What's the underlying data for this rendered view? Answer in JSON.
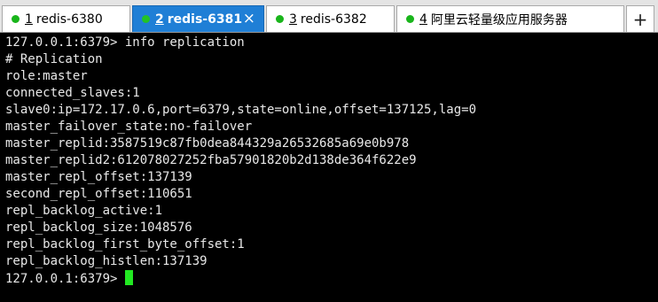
{
  "tabs": [
    {
      "num": "1",
      "label": "redis-6380",
      "active": false
    },
    {
      "num": "2",
      "label": "redis-6381",
      "active": true
    },
    {
      "num": "3",
      "label": "redis-6382",
      "active": false
    },
    {
      "num": "4",
      "label": "阿里云轻量级应用服务器",
      "active": false
    }
  ],
  "tab_close_glyph": "×",
  "add_tab_glyph": "+",
  "terminal": {
    "lines": [
      "127.0.0.1:6379> info replication",
      "# Replication",
      "role:master",
      "connected_slaves:1",
      "slave0:ip=172.17.0.6,port=6379,state=online,offset=137125,lag=0",
      "master_failover_state:no-failover",
      "master_replid:3587519c87fb0dea844329a26532685a69e0b978",
      "master_replid2:612078027252fba57901820b2d138de364f622e9",
      "master_repl_offset:137139",
      "second_repl_offset:110651",
      "repl_backlog_active:1",
      "repl_backlog_size:1048576",
      "repl_backlog_first_byte_offset:1",
      "repl_backlog_histlen:137139"
    ],
    "prompt": "127.0.0.1:6379> "
  },
  "colors": {
    "active_tab": "#1f7fd6",
    "status_dot": "#19b51b",
    "cursor": "#22e822",
    "terminal_bg": "#000000"
  }
}
